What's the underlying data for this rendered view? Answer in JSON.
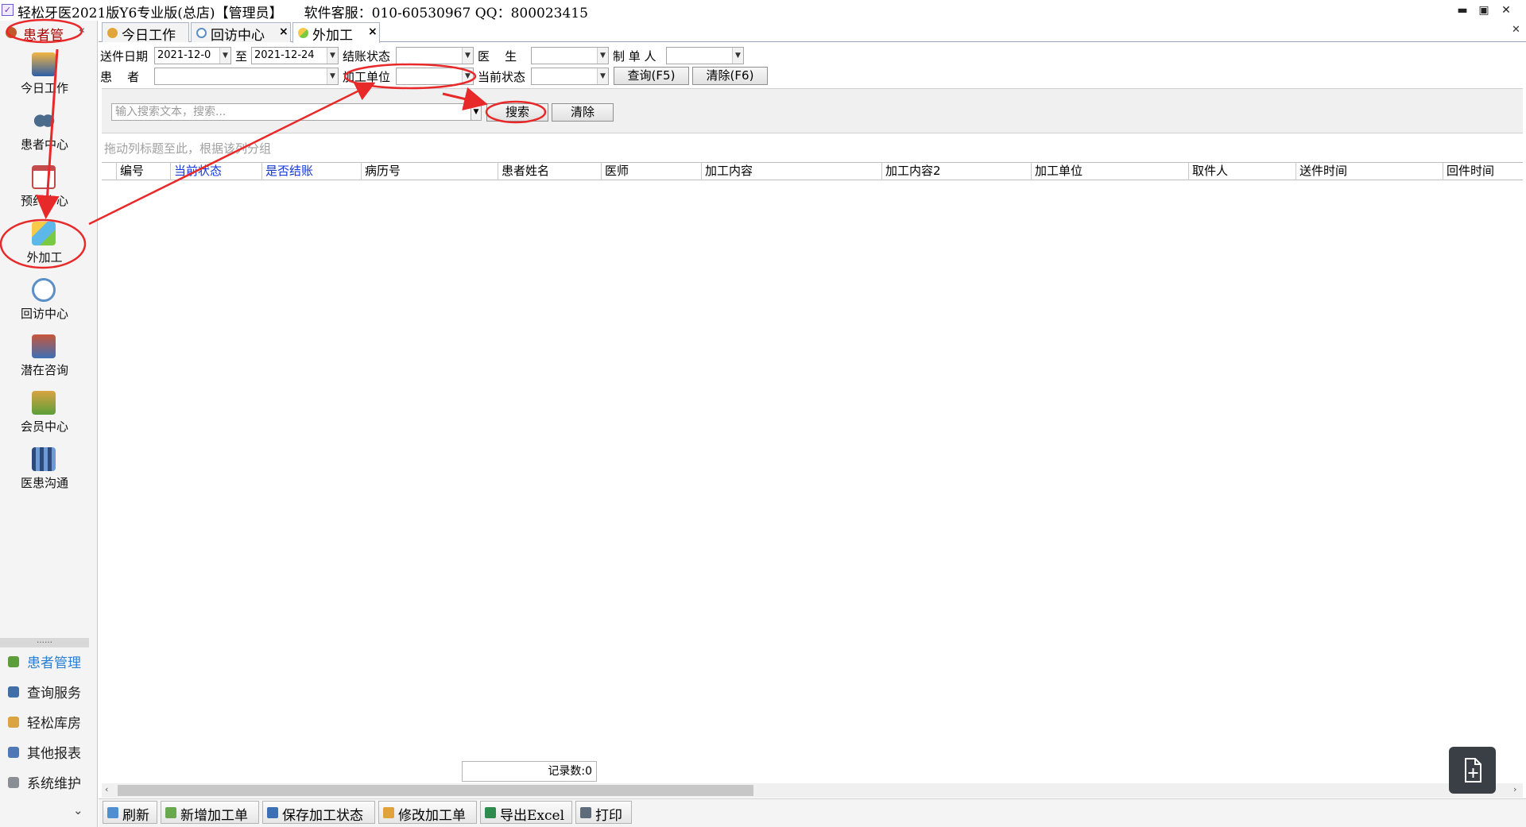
{
  "window": {
    "title": "轻松牙医2021版Y6专业版(总店)【管理员】     软件客服：010-60530967 QQ：800023415",
    "minimize": "▬",
    "restore": "▣",
    "close": "✕",
    "pane_close": "✕"
  },
  "sidebar": {
    "header_label": "患者管",
    "collapse_glyph": "«",
    "items": [
      {
        "label": "今日工作",
        "icon": "worker-icon"
      },
      {
        "label": "患者中心",
        "icon": "binoculars-icon"
      },
      {
        "label": "预约中心",
        "icon": "calendar-icon"
      },
      {
        "label": "外加工",
        "icon": "cubes-icon"
      },
      {
        "label": "回访中心",
        "icon": "refresh-icon"
      },
      {
        "label": "潜在咨询",
        "icon": "consult-icon"
      },
      {
        "label": "会员中心",
        "icon": "members-icon"
      },
      {
        "label": "医患沟通",
        "icon": "clapper-icon"
      }
    ],
    "dots": "……",
    "modules": [
      {
        "label": "患者管理",
        "icon": "patients-icon",
        "active": true
      },
      {
        "label": "查询服务",
        "icon": "query-icon"
      },
      {
        "label": "轻松库房",
        "icon": "warehouse-icon"
      },
      {
        "label": "其他报表",
        "icon": "report-icon"
      },
      {
        "label": "系统维护",
        "icon": "maintenance-icon"
      }
    ],
    "more_glyph": "⌄"
  },
  "tabs": [
    {
      "label": "今日工作",
      "closable": false,
      "active": false
    },
    {
      "label": "回访中心",
      "closable": true,
      "active": false
    },
    {
      "label": "外加工",
      "closable": true,
      "active": true
    }
  ],
  "tab_close_glyph": "×",
  "filters": {
    "send_date_label": "送件日期",
    "send_date_from": "2021-12-0",
    "to_label": "至",
    "send_date_to": "2021-12-24",
    "settle_status_label": "结账状态",
    "settle_status_value": "",
    "doctor_label": "医    生",
    "doctor_value": "",
    "maker_label": "制 单 人",
    "maker_value": "",
    "patient_label": "患    者",
    "patient_value": "",
    "lab_unit_label": "加工单位",
    "lab_unit_value": "",
    "current_status_label": "当前状态",
    "current_status_value": "",
    "query_button": "查询(F5)",
    "clear_button": "清除(F6)",
    "dropdown_glyph": "▼"
  },
  "search": {
    "placeholder": "输入搜索文本，搜索...",
    "search_button": "搜索",
    "clear_button": "清除"
  },
  "grid": {
    "group_hint": "拖动列标题至此，根据该列分组",
    "columns": [
      {
        "label": "编号",
        "highlight": false
      },
      {
        "label": "当前状态",
        "highlight": true
      },
      {
        "label": "是否结账",
        "highlight": true
      },
      {
        "label": "病历号",
        "highlight": false
      },
      {
        "label": "患者姓名",
        "highlight": false
      },
      {
        "label": "医师",
        "highlight": false
      },
      {
        "label": "加工内容",
        "highlight": false
      },
      {
        "label": "加工内容2",
        "highlight": false
      },
      {
        "label": "加工单位",
        "highlight": false
      },
      {
        "label": "取件人",
        "highlight": false
      },
      {
        "label": "送件时间",
        "highlight": false
      },
      {
        "label": "回件时间",
        "highlight": false
      }
    ],
    "rows": [],
    "record_count": "记录数:0"
  },
  "scroll": {
    "left": "‹",
    "right": "›"
  },
  "toolbar": [
    {
      "label": "刷新",
      "icon": "refresh-icon"
    },
    {
      "label": "新增加工单",
      "icon": "add-order-icon"
    },
    {
      "label": "保存加工状态",
      "icon": "save-icon"
    },
    {
      "label": "修改加工单",
      "icon": "edit-icon"
    },
    {
      "label": "导出Excel",
      "icon": "excel-icon"
    },
    {
      "label": "打印",
      "icon": "print-icon"
    }
  ],
  "float_button": {
    "icon": "new-document-icon"
  },
  "colors": {
    "annotation_red": "#e8292a",
    "highlight_blue": "#1536d8",
    "active_module": "#2b7fd4"
  }
}
